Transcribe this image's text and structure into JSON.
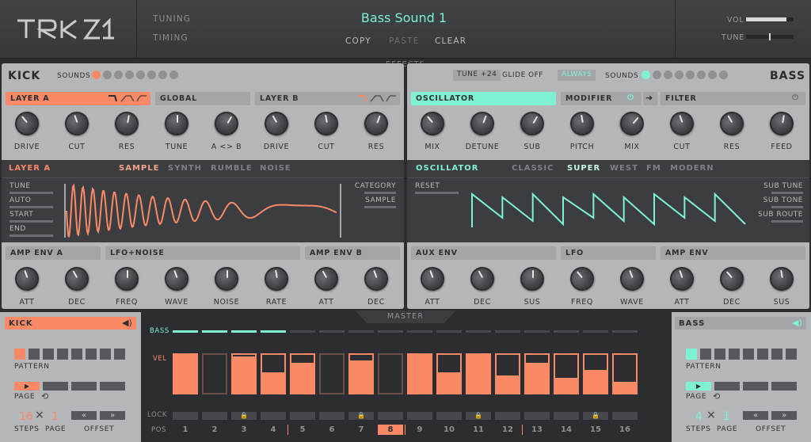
{
  "logo": "TRK 01",
  "top": {
    "menu": [
      "TUNING",
      "TIMING"
    ],
    "sound_name": "Bass Sound 1",
    "actions": [
      "COPY",
      "PASTE",
      "CLEAR"
    ],
    "vol_label": "VOL",
    "tune_label": "TUNE",
    "vol_level": 0.85,
    "tune_level": 0.55
  },
  "effects_label": "EFFECTS",
  "master_label": "MASTER",
  "kick": {
    "title": "KICK",
    "sounds_label": "SOUNDS",
    "sound_count": 8,
    "active_sound": 1,
    "sections": {
      "layer_a": "LAYER A",
      "global": "GLOBAL",
      "layer_b": "LAYER B"
    },
    "knobs": [
      "DRIVE",
      "CUT",
      "RES",
      "TUNE",
      "A <> B",
      "DRIVE",
      "CUT",
      "RES"
    ],
    "layer_label": "LAYER A",
    "tabs": [
      "SAMPLE",
      "SYNTH",
      "RUMBLE",
      "NOISE"
    ],
    "active_tab": "SAMPLE",
    "left_params": [
      "TUNE",
      "AUTO",
      "START",
      "END"
    ],
    "right_params": [
      "CATEGORY",
      "SAMPLE"
    ],
    "env_sections": [
      "AMP ENV A",
      "LFO+NOISE",
      "AMP ENV B"
    ],
    "env_knobs": [
      "ATT",
      "DEC",
      "FREQ",
      "WAVE",
      "NOISE",
      "RATE",
      "ATT",
      "DEC"
    ]
  },
  "bass": {
    "title": "BASS",
    "sounds_label": "SOUNDS",
    "sound_count": 8,
    "active_sound": 1,
    "tune": "TUNE +24",
    "glide": "GLIDE",
    "glide_val": "OFF",
    "always": "ALWAYS",
    "sections": {
      "oscillator": "OSCILLATOR",
      "modifier": "MODIFIER",
      "filter": "FILTER"
    },
    "knobs": [
      "MIX",
      "DETUNE",
      "SUB",
      "PITCH",
      "MIX",
      "CUT",
      "RES",
      "FEED"
    ],
    "osc_label": "OSCILLATOR",
    "tabs": [
      "CLASSIC",
      "SUPER",
      "WEST",
      "FM",
      "MODERN"
    ],
    "active_tab": "SUPER",
    "left_params": [
      "RESET"
    ],
    "right_params": [
      "SUB TUNE",
      "SUB TONE",
      "SUB ROUTE"
    ],
    "env_sections": [
      "AUX ENV",
      "LFO",
      "AMP ENV"
    ],
    "env_knobs": [
      "ATT",
      "DEC",
      "SUS",
      "FREQ",
      "WAVE",
      "ATT",
      "DEC",
      "SUS"
    ]
  },
  "seq_left": {
    "title": "KICK",
    "pattern_label": "PATTERN",
    "page_label": "PAGE",
    "steps": "16",
    "page": "1",
    "steps_label": "STEPS",
    "page_label2": "PAGE",
    "offset_label": "OFFSET",
    "prev": "«",
    "next": "»"
  },
  "seq_right": {
    "title": "BASS",
    "pattern_label": "PATTERN",
    "page_label": "PAGE",
    "steps": "4",
    "page": "1",
    "steps_label": "STEPS",
    "page_label2": "PAGE",
    "offset_label": "OFFSET",
    "prev": "«",
    "next": "»"
  },
  "seq": {
    "bass_label": "BASS",
    "vel_label": "VEL",
    "lock_label": "LOCK",
    "pos_label": "POS",
    "bass_active": [
      1,
      1,
      1,
      1,
      0,
      0,
      0,
      0,
      0,
      0,
      0,
      0,
      0,
      0,
      0,
      0
    ],
    "vel": [
      1.0,
      0,
      0.95,
      0.55,
      0.8,
      0,
      0.85,
      0,
      1.0,
      0.55,
      1.0,
      0.45,
      0.8,
      0.4,
      0.6,
      0.3
    ],
    "active": [
      1,
      0,
      1,
      1,
      1,
      0,
      1,
      0,
      1,
      1,
      1,
      1,
      1,
      1,
      1,
      1
    ],
    "locks": [
      0,
      0,
      1,
      0,
      0,
      0,
      1,
      0,
      0,
      0,
      1,
      0,
      0,
      0,
      1,
      0
    ],
    "pos": [
      "1",
      "2",
      "3",
      "4",
      "5",
      "6",
      "7",
      "8",
      "9",
      "10",
      "11",
      "12",
      "13",
      "14",
      "15",
      "16"
    ],
    "current": 8
  },
  "colors": {
    "orange": "#fa8a66",
    "teal": "#7ef2d3"
  }
}
